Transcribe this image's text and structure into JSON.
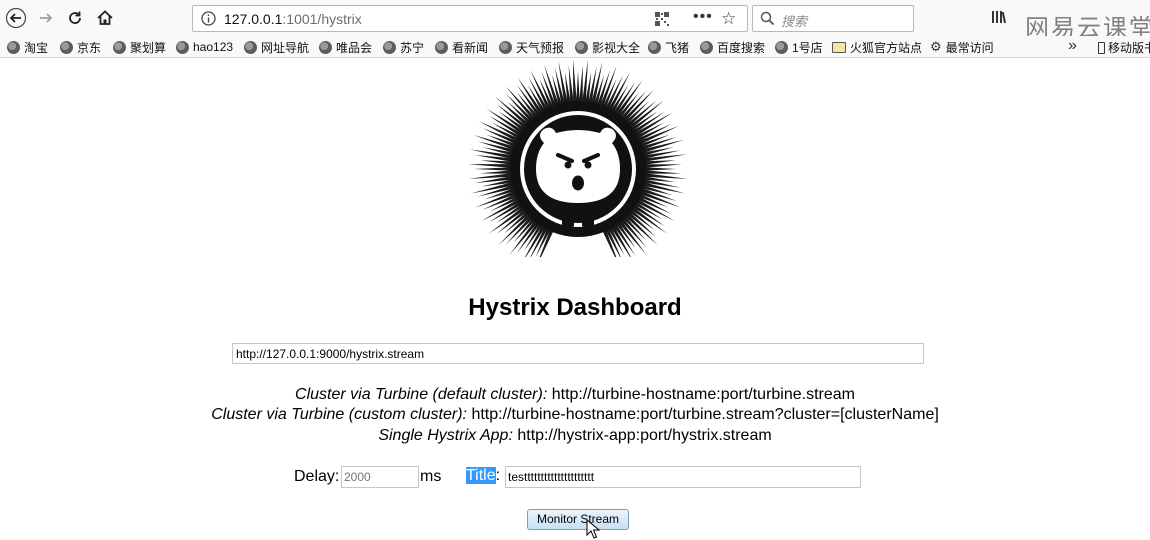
{
  "browser": {
    "url_host": "127.0.0.1",
    "url_path": ":1001/hystrix",
    "search_placeholder": "搜索",
    "watermark": "网易云课堂",
    "bookmarks": [
      {
        "label": "淘宝",
        "icon": "globe-icon"
      },
      {
        "label": "京东",
        "icon": "globe-icon"
      },
      {
        "label": "聚划算",
        "icon": "globe-icon"
      },
      {
        "label": "hao123",
        "icon": "globe-icon"
      },
      {
        "label": "网址导航",
        "icon": "globe-icon"
      },
      {
        "label": "唯品会",
        "icon": "globe-icon"
      },
      {
        "label": "苏宁",
        "icon": "globe-icon"
      },
      {
        "label": "看新闻",
        "icon": "globe-icon"
      },
      {
        "label": "天气预报",
        "icon": "globe-icon"
      },
      {
        "label": "影视大全",
        "icon": "globe-icon"
      },
      {
        "label": "飞猪",
        "icon": "globe-icon"
      },
      {
        "label": "百度搜索",
        "icon": "globe-icon"
      },
      {
        "label": "1号店",
        "icon": "globe-icon"
      },
      {
        "label": "火狐官方站点",
        "icon": "folder-icon"
      },
      {
        "label": "最常访问",
        "icon": "gear-icon"
      }
    ],
    "mobile_bookmarks": "移动版书"
  },
  "page": {
    "title": "Hystrix Dashboard",
    "stream_url": "http://127.0.0.1:9000/hystrix.stream",
    "help": [
      {
        "label": "Cluster via Turbine (default cluster):",
        "value": "http://turbine-hostname:port/turbine.stream"
      },
      {
        "label": "Cluster via Turbine (custom cluster):",
        "value": "http://turbine-hostname:port/turbine.stream?cluster=[clusterName]"
      },
      {
        "label": "Single Hystrix App:",
        "value": "http://hystrix-app:port/hystrix.stream"
      }
    ],
    "delay_label": "Delay:",
    "delay_placeholder": "2000",
    "delay_unit": "ms",
    "title_label": "Title",
    "title_colon": ":",
    "title_value": "testtttttttttttttttttttt",
    "monitor_button": "Monitor Stream"
  },
  "colors": {
    "selection": "#3399ff",
    "button_top": "#eaf4fc",
    "button_bottom": "#c7e0f4"
  }
}
